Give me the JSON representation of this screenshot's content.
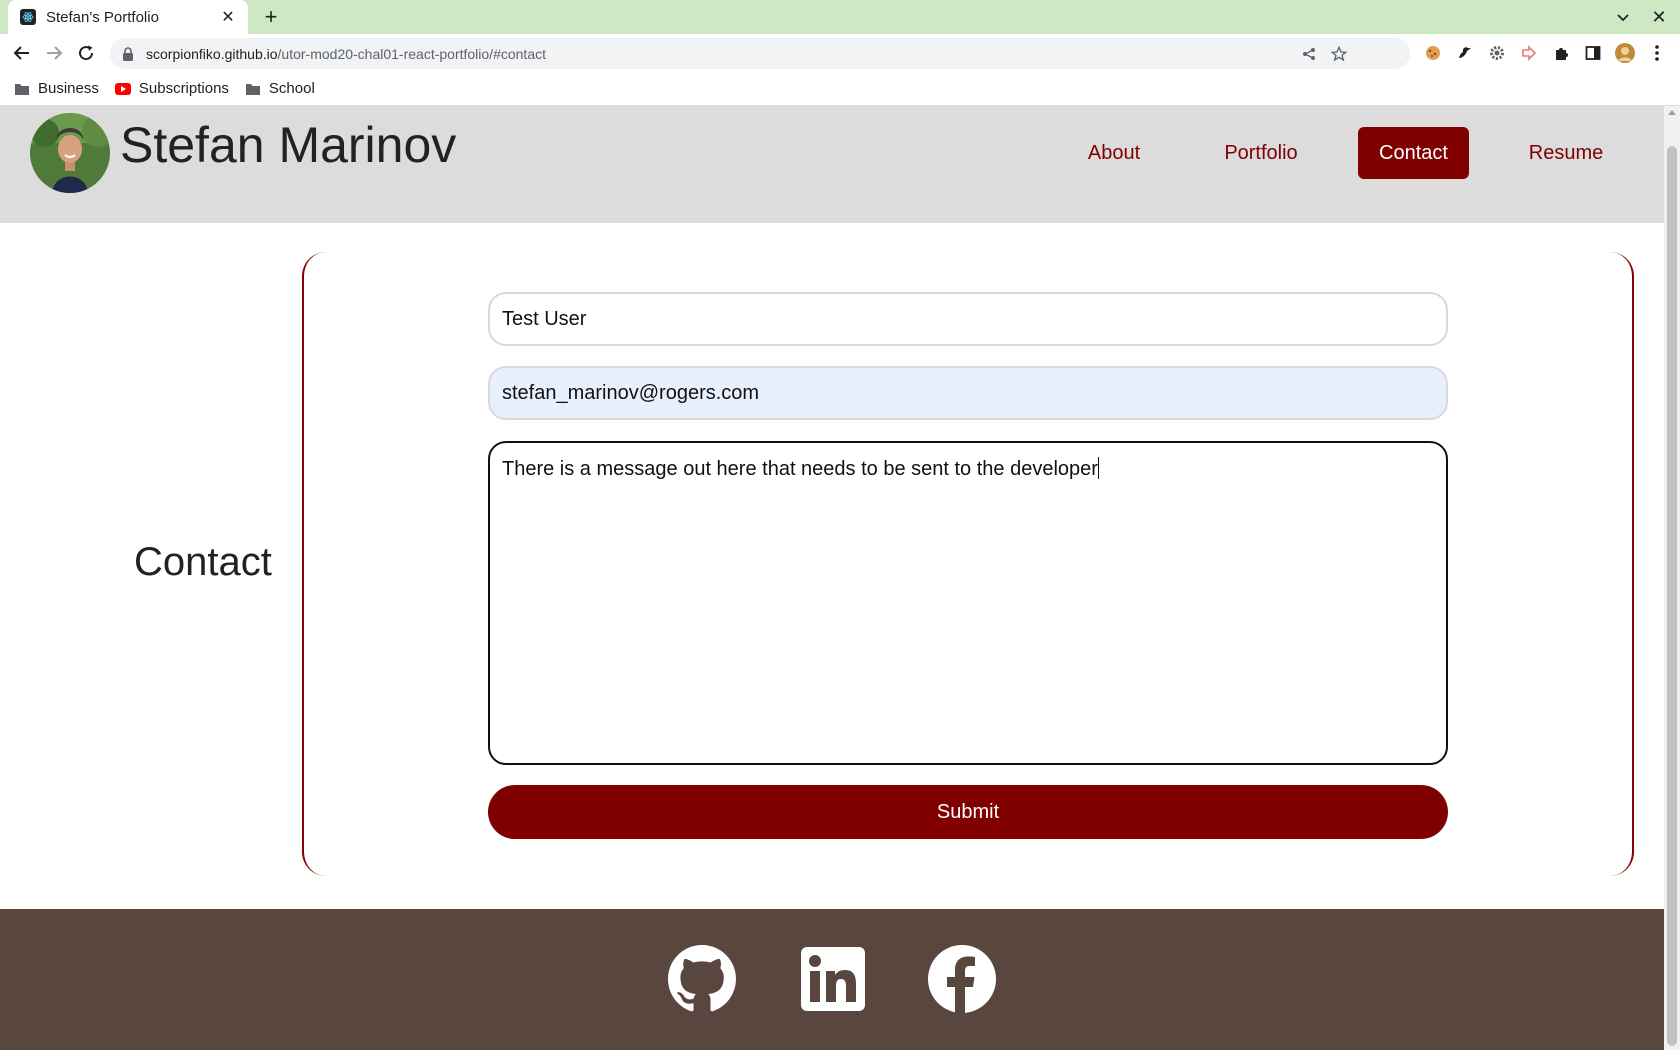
{
  "browser": {
    "tab_title": "Stefan's Portfolio",
    "new_tab": "+",
    "close": "✕",
    "url_host": "scorpionfiko.github.io",
    "url_path": "/utor-mod20-chal01-react-portfolio/#contact",
    "bookmarks": [
      {
        "label": "Business",
        "icon": "folder-icon"
      },
      {
        "label": "Subscriptions",
        "icon": "youtube-icon"
      },
      {
        "label": "School",
        "icon": "folder-icon"
      }
    ]
  },
  "header": {
    "name": "Stefan Marinov",
    "nav": [
      "About",
      "Portfolio",
      "Contact",
      "Resume"
    ],
    "active": "Contact"
  },
  "contact": {
    "heading": "Contact",
    "name_value": "Test User",
    "email_value": "stefan_marinov@rogers.com",
    "message_value": "There is a message out here that needs to be sent to the developer",
    "submit_label": "Submit"
  },
  "footer": {
    "links": [
      "github-icon",
      "linkedin-icon",
      "facebook-icon"
    ]
  },
  "colors": {
    "accent": "#800000",
    "header_bg": "#dcdcdc",
    "footer_bg": "#58463f",
    "tabbar_bg": "#cfe8c4"
  }
}
